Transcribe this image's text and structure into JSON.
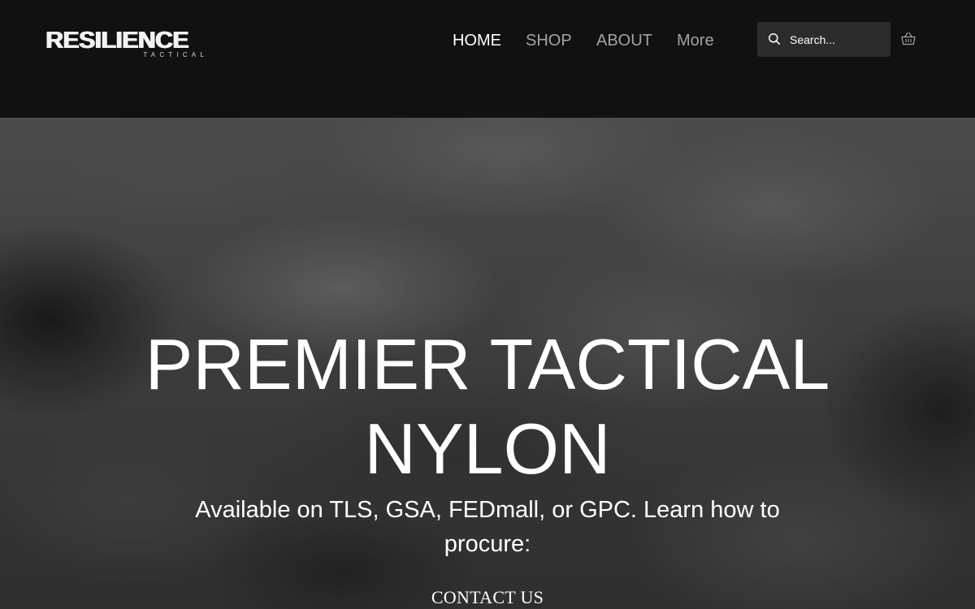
{
  "header": {
    "logo": {
      "main": "RESILIENCE",
      "sub": "TACTICAL"
    },
    "nav": [
      {
        "label": "HOME",
        "active": true
      },
      {
        "label": "SHOP",
        "active": false
      },
      {
        "label": "ABOUT",
        "active": false
      },
      {
        "label": "More",
        "active": false
      }
    ],
    "search": {
      "placeholder": "Search...",
      "value": ""
    },
    "icons": {
      "search": "search-icon",
      "cart": "shopping-basket-icon"
    }
  },
  "hero": {
    "title": "PREMIER TACTICAL NYLON",
    "subtitle": "Available on TLS, GSA, FEDmall, or GPC. Learn how to procure:",
    "cta_label": "CONTACT US"
  },
  "colors": {
    "header_bg": "#111111",
    "search_bg": "#2c2c2c",
    "nav_active": "#ffffff",
    "nav_inactive": "#a3a3a3",
    "hero_text": "#ffffff"
  }
}
